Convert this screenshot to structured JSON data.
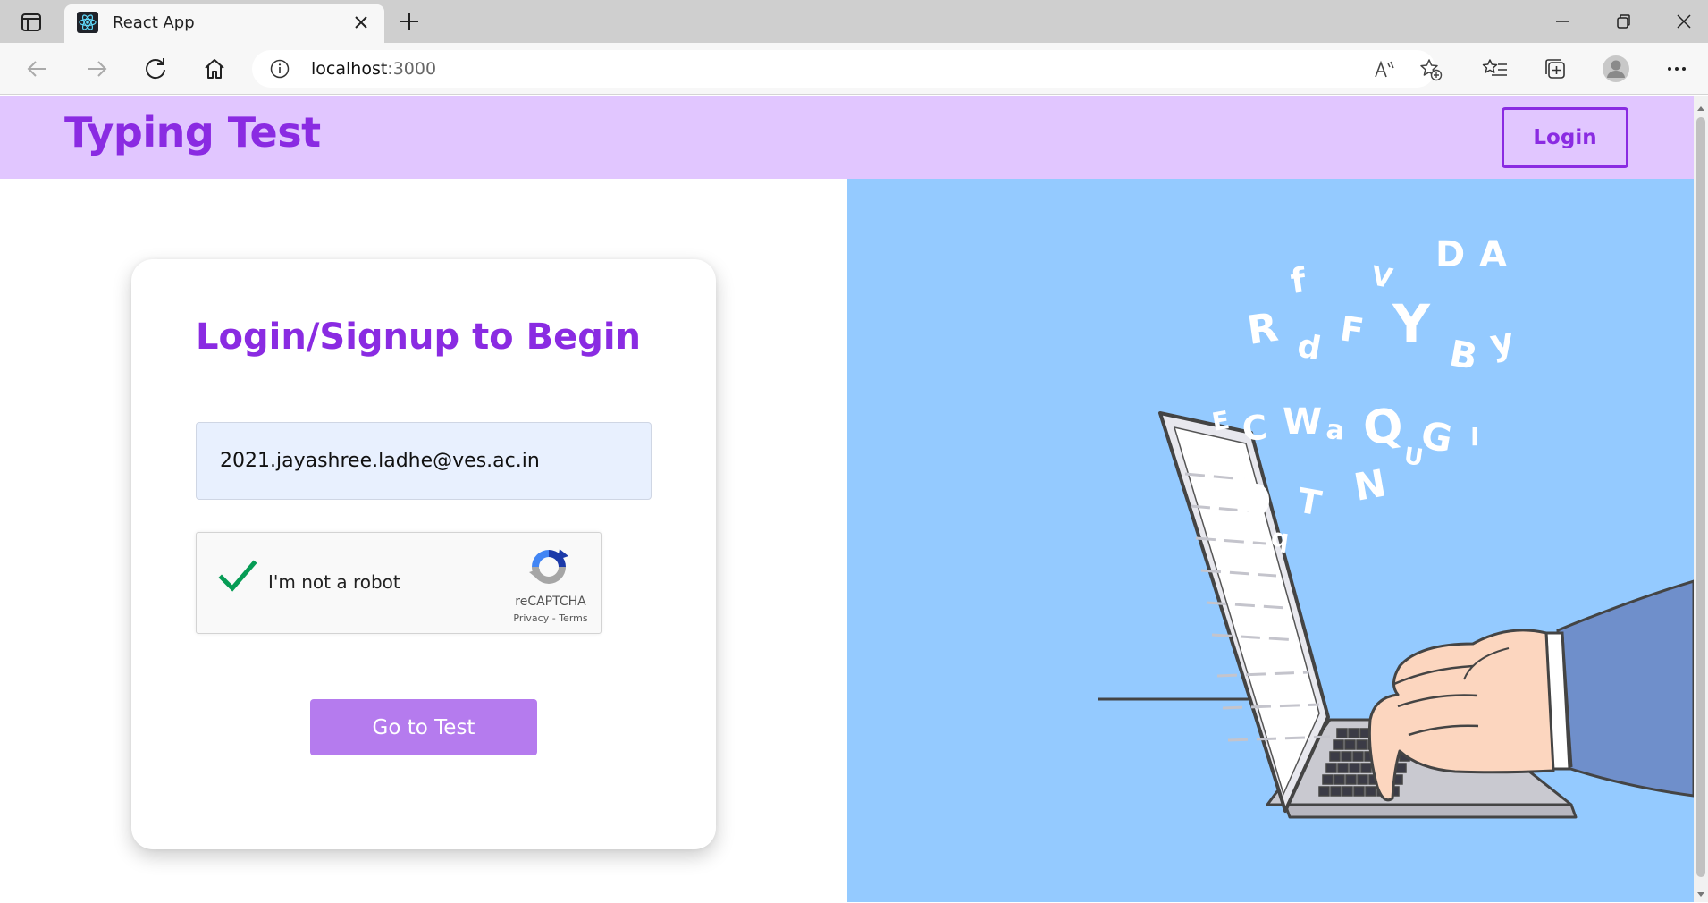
{
  "browser": {
    "tab_title": "React App",
    "url_host": "localhost",
    "url_port": ":3000"
  },
  "header": {
    "brand": "Typing Test",
    "login_label": "Login"
  },
  "login_card": {
    "title": "Login/Signup to Begin",
    "email_value": "2021.jayashree.ladhe@ves.ac.in",
    "captcha_label": "I'm not a robot",
    "captcha_brand": "reCAPTCHA",
    "captcha_links": "Privacy - Terms",
    "submit_label": "Go to Test"
  },
  "illustration": {
    "letters": [
      "f",
      "V",
      "D",
      "A",
      "R",
      "d",
      "F",
      "Y",
      "B",
      "y",
      "Q",
      "G",
      "E",
      "C",
      "W",
      "a",
      "U",
      "I",
      "b",
      "T",
      "N",
      "q"
    ]
  },
  "colors": {
    "accent": "#8a2be2",
    "header_bg": "#e1c6ff",
    "button_bg": "#b57bee",
    "illustration_bg": "#94caff"
  }
}
